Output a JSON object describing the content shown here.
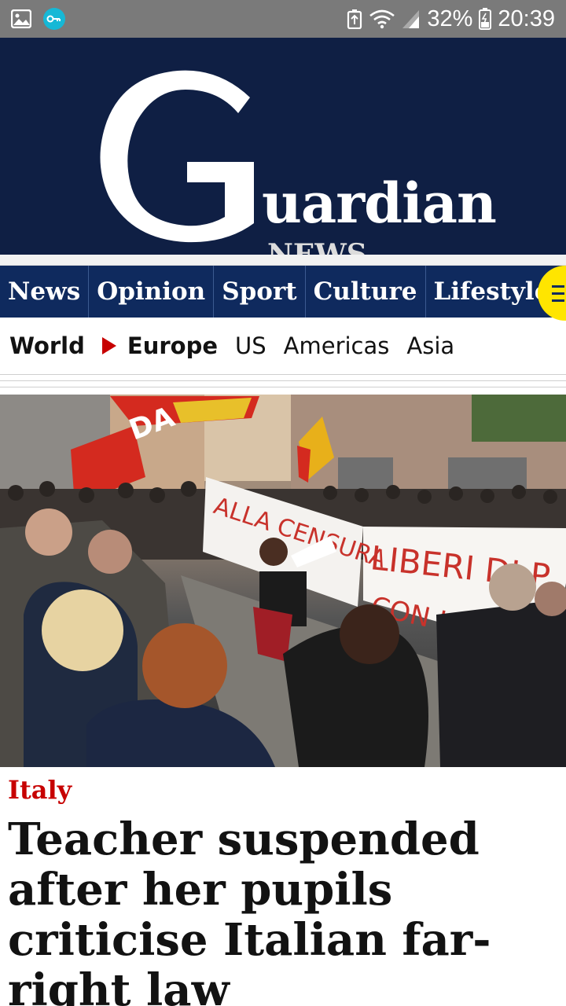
{
  "status_bar": {
    "battery": "32%",
    "time": "20:39",
    "icons": [
      "gallery-icon",
      "vpn-key-icon",
      "battery-saver-icon",
      "wifi-icon",
      "signal-icon",
      "battery-icon"
    ]
  },
  "masthead": {
    "logo_word": "uardian",
    "logo_sub": "NEWS",
    "logo_letter": "G"
  },
  "nav": {
    "items": [
      "News",
      "Opinion",
      "Sport",
      "Culture",
      "Lifestyle"
    ],
    "menu_icon": "hamburger-icon",
    "menu_color": "#ffe500"
  },
  "subnav": {
    "items": [
      "World",
      "Europe",
      "US",
      "Americas",
      "Asia"
    ],
    "arrow_color": "#c70000"
  },
  "hero": {
    "banner_left": "ALLA CENSURA",
    "banner_right": "LIBERI DI P",
    "banner_right_line2": "CON LA N",
    "flag_text": "DA"
  },
  "article": {
    "kicker": "Italy",
    "headline": "Teacher suspended after her pupils criticise Italian far-right law"
  },
  "colors": {
    "masthead_bg": "#0f1f44",
    "nav_bg": "#0f2a5e",
    "kicker": "#c70000"
  }
}
